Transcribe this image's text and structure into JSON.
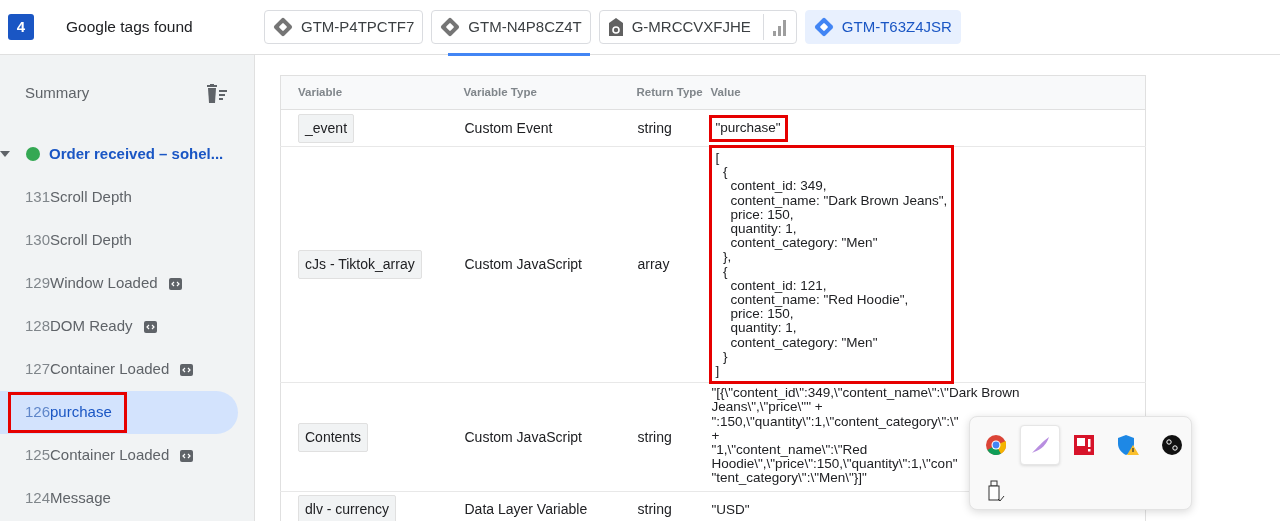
{
  "header": {
    "count": "4",
    "title": "Google tags found"
  },
  "tags": [
    {
      "label": "GTM-P4TPCTF7",
      "kind": "gtm",
      "selected": false,
      "underlined": false
    },
    {
      "label": "GTM-N4P8CZ4T",
      "kind": "gtm",
      "selected": false,
      "underlined": true
    },
    {
      "label": "G-MRCCVXFJHE",
      "kind": "ga",
      "selected": false,
      "underlined": false
    },
    {
      "label": "GTM-T63Z4JSR",
      "kind": "gtm",
      "selected": true,
      "underlined": false
    }
  ],
  "sidebar": {
    "summary": "Summary",
    "group": {
      "label": "Order received – sohel...",
      "expanded": true,
      "color": "#34a853",
      "items": [
        {
          "number": "131",
          "name": "Scroll Depth",
          "code": false,
          "selected": false,
          "highlighted": false
        },
        {
          "number": "130",
          "name": "Scroll Depth",
          "code": false,
          "selected": false,
          "highlighted": false
        },
        {
          "number": "129",
          "name": "Window Loaded",
          "code": true,
          "selected": false,
          "highlighted": false
        },
        {
          "number": "128",
          "name": "DOM Ready",
          "code": true,
          "selected": false,
          "highlighted": false
        },
        {
          "number": "127",
          "name": "Container Loaded",
          "code": true,
          "selected": false,
          "highlighted": false
        },
        {
          "number": "126",
          "name": "purchase",
          "code": false,
          "selected": true,
          "highlighted": true
        },
        {
          "number": "125",
          "name": "Container Loaded",
          "code": true,
          "selected": false,
          "highlighted": false
        },
        {
          "number": "124",
          "name": "Message",
          "code": false,
          "selected": false,
          "highlighted": false
        }
      ]
    }
  },
  "table": {
    "columns": [
      "Variable",
      "Variable Type",
      "Return Type",
      "Value"
    ],
    "rows": [
      {
        "variable": "_event",
        "type": "Custom Event",
        "return_type": "string",
        "value": "\"purchase\"",
        "highlighted": true
      },
      {
        "variable": "cJs - Tiktok_array",
        "type": "Custom JavaScript",
        "return_type": "array",
        "value": "[\n  {\n    content_id: 349,\n    content_name: \"Dark Brown Jeans\",\n    price: 150,\n    quantity: 1,\n    content_category: \"Men\"\n  },\n  {\n    content_id: 121,\n    content_name: \"Red Hoodie\",\n    price: 150,\n    quantity: 1,\n    content_category: \"Men\"\n  }\n]",
        "highlighted": true
      },
      {
        "variable": "Contents",
        "type": "Custom JavaScript",
        "return_type": "string",
        "value": "\"[{\\\"content_id\\\":349,\\\"content_name\\\":\\\"Dark Brown\nJeans\\\",\\\"price\\\"\" +\n\":150,\\\"quantity\\\":1,\\\"content_category\\\":\\\"\n+\n\"1,\\\"content_name\\\":\\\"Red\nHoodie\\\",\\\"price\\\":150,\\\"quantity\\\":1,\\\"con\"\n\"tent_category\\\":\\\"Men\\\"}]\"",
        "highlighted": false
      },
      {
        "variable": "dlv - currency",
        "type": "Data Layer Variable",
        "return_type": "string",
        "value": "\"USD\"",
        "highlighted": false
      }
    ]
  },
  "tray": {
    "icons": [
      {
        "kind": "chrome",
        "selected": false
      },
      {
        "kind": "feather",
        "selected": true
      },
      {
        "kind": "amd",
        "selected": false
      },
      {
        "kind": "shield",
        "selected": false
      },
      {
        "kind": "bo",
        "selected": false
      },
      {
        "kind": "usb",
        "selected": false
      }
    ]
  }
}
